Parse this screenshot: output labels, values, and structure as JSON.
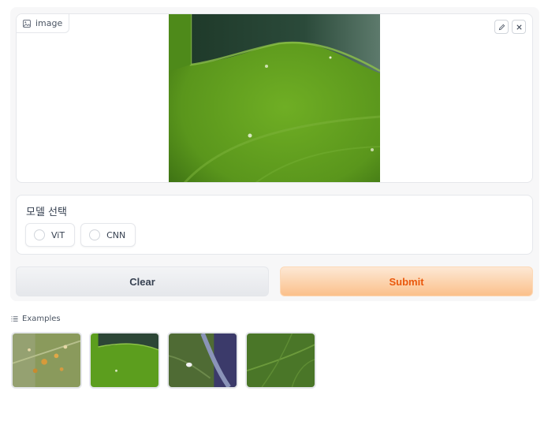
{
  "image_component": {
    "label": "image",
    "icon": "image-icon",
    "tools": [
      {
        "icon": "pencil-icon"
      },
      {
        "icon": "close-icon"
      }
    ]
  },
  "model_select": {
    "title": "모델 선택",
    "options": [
      {
        "label": "ViT",
        "selected": false
      },
      {
        "label": "CNN",
        "selected": false
      }
    ]
  },
  "actions": {
    "clear_label": "Clear",
    "submit_label": "Submit"
  },
  "examples": {
    "label": "Examples",
    "icon": "list-icon",
    "count": 4
  },
  "colors": {
    "submit_text": "#ea580c",
    "submit_bg_start": "#fde8d4",
    "submit_bg_end": "#fbc08b",
    "leaf_green": "#5a9a1e"
  }
}
